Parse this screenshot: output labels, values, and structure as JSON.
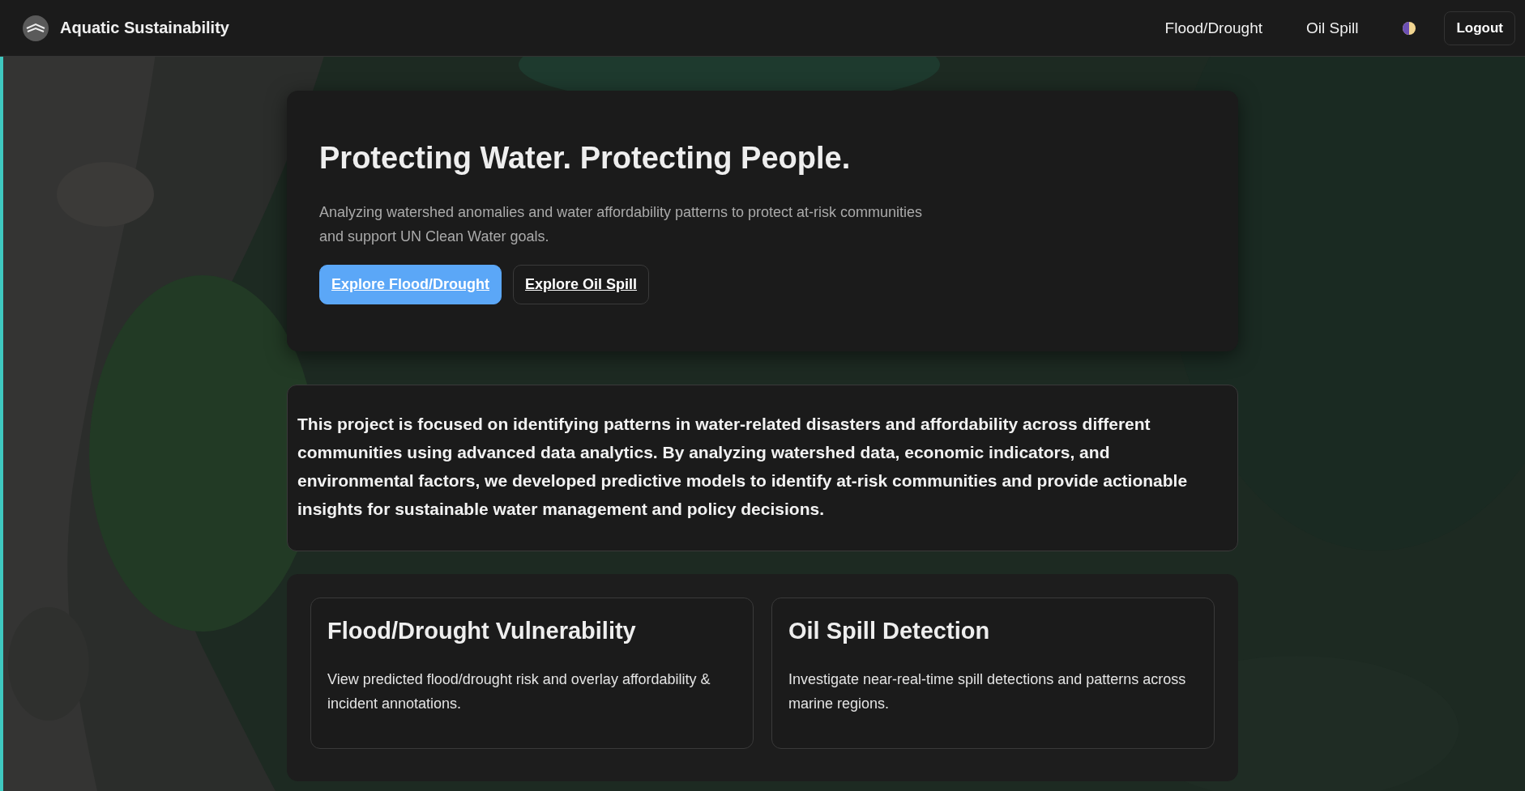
{
  "navbar": {
    "brand": "Aquatic Sustainability",
    "links": [
      {
        "label": "Flood/Drought"
      },
      {
        "label": "Oil Spill"
      }
    ],
    "logout": "Logout"
  },
  "hero": {
    "title": "Protecting Water. Protecting People.",
    "subtitle": "Analyzing watershed anomalies and water affordability patterns to protect at-risk communities and support UN Clean Water goals.",
    "buttons": [
      {
        "label": "Explore Flood/Drought",
        "kind": "primary"
      },
      {
        "label": "Explore Oil Spill",
        "kind": "secondary"
      }
    ]
  },
  "about": {
    "text": "This project is focused on identifying patterns in water-related disasters and affordability across different communities using advanced data analytics. By analyzing watershed data, economic indicators, and environmental factors, we developed predictive models to identify at-risk communities and provide actionable insights for sustainable water management and policy decisions."
  },
  "features": [
    {
      "title": "Flood/Drought Vulnerability",
      "description": "View predicted flood/drought risk and overlay affordability & incident annotations."
    },
    {
      "title": "Oil Spill Detection",
      "description": "Investigate near-real-time spill detections and patterns across marine regions."
    }
  ]
}
